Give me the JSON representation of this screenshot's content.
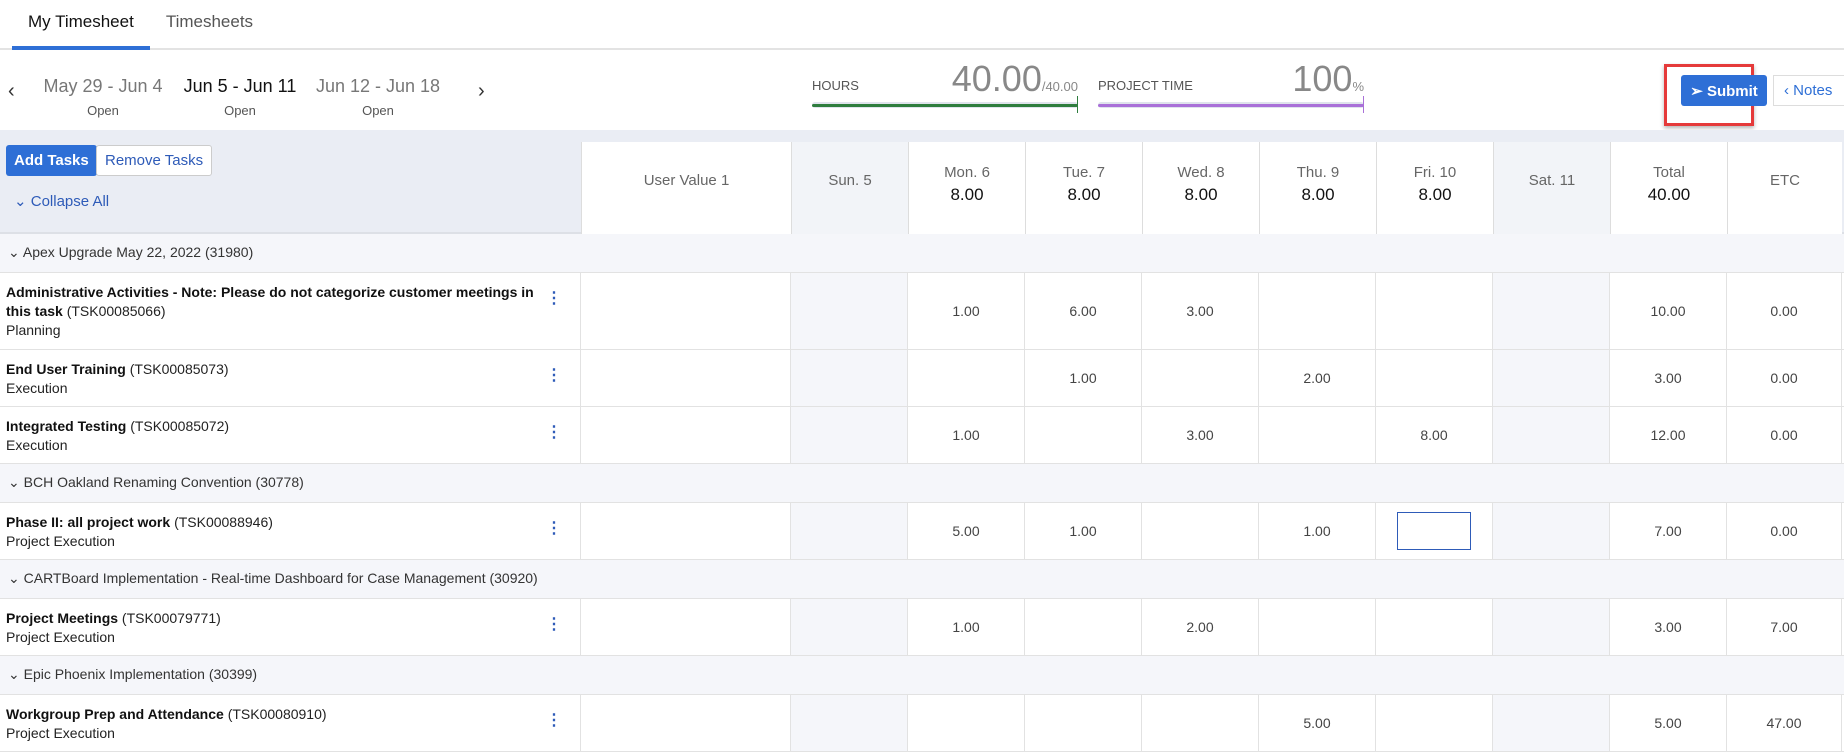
{
  "tabs": [
    {
      "label": "My Timesheet",
      "active": true
    },
    {
      "label": "Timesheets",
      "active": false
    }
  ],
  "weeks": [
    {
      "range": "May 29 - Jun 4",
      "status": "Open"
    },
    {
      "range": "Jun 5 - Jun 11",
      "status": "Open",
      "active": true
    },
    {
      "range": "Jun 12 - Jun 18",
      "status": "Open"
    }
  ],
  "meters": {
    "hours": {
      "label": "HOURS",
      "value": "40.00",
      "max": "/40.00",
      "percent": 100,
      "color": "#2e7d3e"
    },
    "project_time": {
      "label": "PROJECT TIME",
      "value": "100",
      "unit": "%",
      "percent": 100,
      "color": "#a970d8"
    }
  },
  "actions": {
    "submit": "Submit",
    "notes": "Notes",
    "add_tasks": "Add Tasks",
    "remove_tasks": "Remove Tasks",
    "collapse_all": "Collapse All"
  },
  "columns": [
    {
      "label": "User Value 1"
    },
    {
      "label": "Sun. 5",
      "weekend": true
    },
    {
      "label": "Mon. 6",
      "total": "8.00"
    },
    {
      "label": "Tue. 7",
      "total": "8.00"
    },
    {
      "label": "Wed. 8",
      "total": "8.00"
    },
    {
      "label": "Thu. 9",
      "total": "8.00"
    },
    {
      "label": "Fri. 10",
      "total": "8.00"
    },
    {
      "label": "Sat. 11",
      "weekend": true
    },
    {
      "label": "Total",
      "total": "40.00"
    },
    {
      "label": "ETC"
    }
  ],
  "groups": [
    {
      "name": "Apex Upgrade May 22, 2022 (31980)",
      "tasks": [
        {
          "name": "Administrative Activities - Note: Please do not categorize customer meetings in this task",
          "id": "(TSK00085066)",
          "phase": "Planning",
          "values": [
            "",
            "",
            "1.00",
            "6.00",
            "3.00",
            "",
            "",
            "",
            "10.00",
            "0.00"
          ]
        },
        {
          "name": "End User Training",
          "id": "(TSK00085073)",
          "phase": "Execution",
          "values": [
            "",
            "",
            "",
            "1.00",
            "",
            "2.00",
            "",
            "",
            "3.00",
            "0.00"
          ]
        },
        {
          "name": "Integrated Testing",
          "id": "(TSK00085072)",
          "phase": "Execution",
          "values": [
            "",
            "",
            "1.00",
            "",
            "3.00",
            "",
            "8.00",
            "",
            "12.00",
            "0.00"
          ]
        }
      ]
    },
    {
      "name": "BCH Oakland Renaming Convention (30778)",
      "tasks": [
        {
          "name": "Phase II: all project work",
          "id": "(TSK00088946)",
          "phase": "Project Execution",
          "values": [
            "",
            "",
            "5.00",
            "1.00",
            "",
            "1.00",
            "",
            "",
            "7.00",
            "0.00"
          ],
          "editing": 6
        }
      ]
    },
    {
      "name": "CARTBoard Implementation - Real-time Dashboard for Case Management (30920)",
      "tasks": [
        {
          "name": "Project Meetings",
          "id": "(TSK00079771)",
          "phase": "Project Execution",
          "values": [
            "",
            "",
            "1.00",
            "",
            "2.00",
            "",
            "",
            "",
            "3.00",
            "7.00"
          ]
        }
      ]
    },
    {
      "name": "Epic Phoenix Implementation (30399)",
      "tasks": [
        {
          "name": "Workgroup Prep and Attendance",
          "id": "(TSK00080910)",
          "phase": "Project Execution",
          "values": [
            "",
            "",
            "",
            "",
            "",
            "5.00",
            "",
            "",
            "5.00",
            "47.00"
          ]
        }
      ]
    }
  ]
}
